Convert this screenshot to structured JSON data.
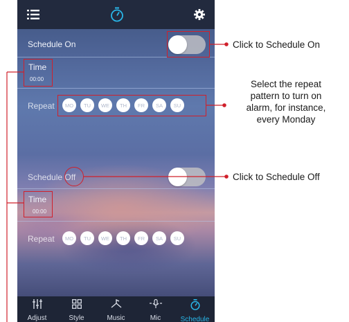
{
  "topbar": {
    "menu_icon": "list-icon",
    "timer_icon": "stopwatch-icon",
    "settings_icon": "gear-icon"
  },
  "schedule_on": {
    "label": "Schedule On",
    "time_label": "Time",
    "time_value": "00:00",
    "repeat_label": "Repeat",
    "days": [
      "MO",
      "TU",
      "WE",
      "TH",
      "FR",
      "SA",
      "SU"
    ]
  },
  "schedule_off": {
    "label_prefix": "Schedule ",
    "label_state": "Off",
    "time_label": "Time",
    "time_value": "00:00",
    "repeat_label": "Repeat",
    "days": [
      "MO",
      "TU",
      "WE",
      "TH",
      "FR",
      "SA",
      "SU"
    ]
  },
  "bottom_nav": [
    {
      "label": "Adjust",
      "icon": "sliders-icon"
    },
    {
      "label": "Style",
      "icon": "grid-icon"
    },
    {
      "label": "Music",
      "icon": "music-icon"
    },
    {
      "label": "Mic",
      "icon": "microphone-icon"
    },
    {
      "label": "Schedule",
      "icon": "stopwatch-icon",
      "active": true
    }
  ],
  "callouts": {
    "schedule_on": "Click to Schedule On",
    "repeat_line1": "Select the repeat",
    "repeat_line2": "pattern to turn on",
    "repeat_line3": "alarm, for instance,",
    "repeat_line4": "every Monday",
    "schedule_off": "Click to Schedule Off"
  },
  "colors": {
    "annotation": "#d0202b",
    "active_nav": "#29b6e8"
  }
}
